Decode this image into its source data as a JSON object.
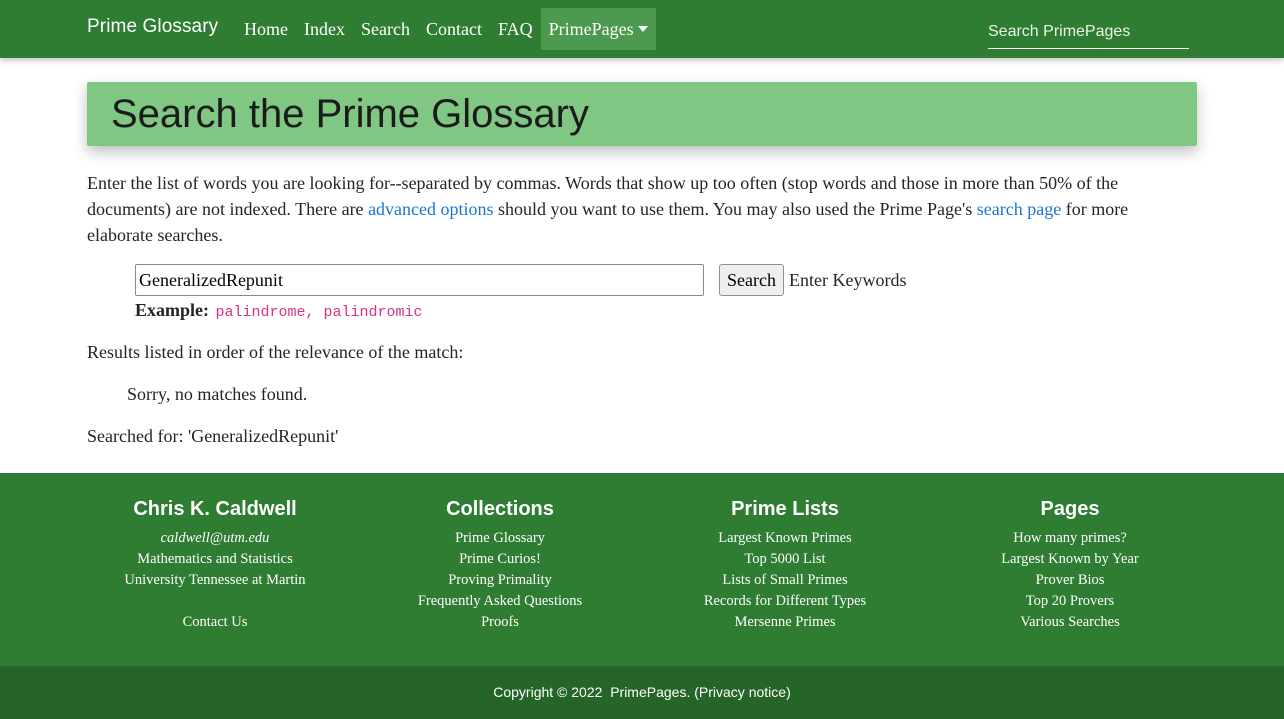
{
  "nav": {
    "brand": "Prime Glossary",
    "items": [
      "Home",
      "Index",
      "Search",
      "Contact",
      "FAQ"
    ],
    "dropdown": "PrimePages",
    "search_placeholder": "Search PrimePages"
  },
  "header": {
    "title": "Search the Prime Glossary"
  },
  "intro": {
    "part1": "Enter the list of words you are looking for--separated by commas.  Words that show up too often (stop words and those in more than 50% of the documents) are not indexed.  There are ",
    "link1": "advanced options",
    "part2": " should you want to use them.  You may also used the Prime Page's ",
    "link2": "search page",
    "part3": " for more elaborate searches."
  },
  "form": {
    "input_value": "GeneralizedRepunit",
    "button_label": "Search",
    "hint": "Enter Keywords",
    "example_label": "Example:",
    "example_value": "palindrome, palindromic"
  },
  "results": {
    "heading": "Results listed in order of the relevance of the match:",
    "message": "Sorry, no matches found.",
    "searched_for": "Searched for: 'GeneralizedRepunit'"
  },
  "footer": {
    "col1": {
      "title": "Chris K. Caldwell",
      "email": "caldwell@utm.edu",
      "lines": [
        "Mathematics and Statistics",
        "University Tennessee at Martin"
      ],
      "contact": "Contact Us"
    },
    "col2": {
      "title": "Collections",
      "links": [
        "Prime Glossary",
        "Prime Curios!",
        "Proving Primality",
        "Frequently Asked Questions",
        "Proofs"
      ]
    },
    "col3": {
      "title": "Prime Lists",
      "links": [
        "Largest Known Primes",
        "Top 5000 List",
        "Lists of Small Primes",
        "Records for Different Types",
        "Mersenne Primes"
      ]
    },
    "col4": {
      "title": "Pages",
      "links": [
        "How many primes?",
        "Largest Known by Year",
        "Prover Bios",
        "Top 20 Provers",
        "Various Searches"
      ]
    }
  },
  "copyright": {
    "text": "Copyright © 2022",
    "site": "PrimePages",
    "open": ".  (",
    "privacy": "Privacy notice",
    "close": ")"
  }
}
